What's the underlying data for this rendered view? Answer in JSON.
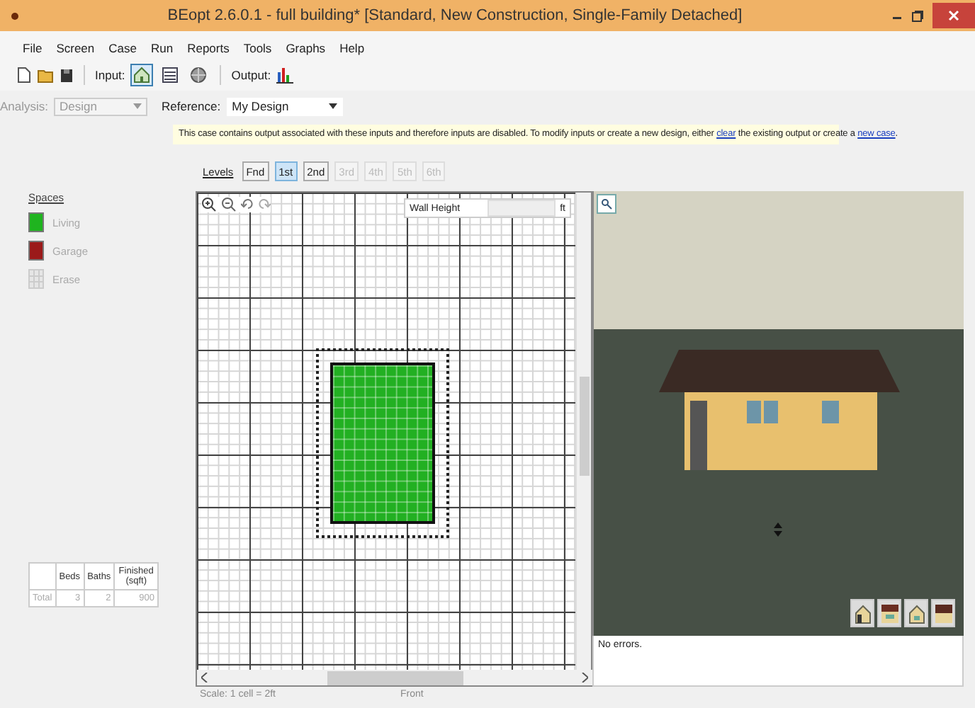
{
  "window": {
    "title": "BEopt 2.6.0.1 - full building* [Standard, New Construction, Single-Family Detached]"
  },
  "menu": [
    "File",
    "Screen",
    "Case",
    "Run",
    "Reports",
    "Tools",
    "Graphs",
    "Help"
  ],
  "toolbar": {
    "input_label": "Input:",
    "input_views": [
      {
        "kind": "house",
        "selected": true
      },
      {
        "kind": "list",
        "selected": false
      },
      {
        "kind": "globe",
        "selected": false
      }
    ],
    "output_label": "Output:"
  },
  "analysis": {
    "label": "Analysis:",
    "value": "Design",
    "disabled": true
  },
  "reference": {
    "label": "Reference:",
    "value": "My Design"
  },
  "banner": [
    {
      "kind": "text",
      "text": "This case contains output associated with these inputs and therefore inputs are disabled. To modify inputs or create a new design, either "
    },
    {
      "kind": "link",
      "text": "clear"
    },
    {
      "kind": "text",
      "text": " the existing output or create a "
    },
    {
      "kind": "link",
      "text": "new case"
    },
    {
      "kind": "text",
      "text": "."
    }
  ],
  "levels": {
    "label": "Levels",
    "items": [
      {
        "label": "Fnd",
        "selected": false,
        "disabled": false
      },
      {
        "label": "1st",
        "selected": true,
        "disabled": false
      },
      {
        "label": "2nd",
        "selected": false,
        "disabled": false
      },
      {
        "label": "3rd",
        "selected": false,
        "disabled": true
      },
      {
        "label": "4th",
        "selected": false,
        "disabled": true
      },
      {
        "label": "5th",
        "selected": false,
        "disabled": true
      },
      {
        "label": "6th",
        "selected": false,
        "disabled": true
      }
    ]
  },
  "spaces": {
    "title": "Spaces",
    "items": [
      {
        "label": "Living",
        "kind": "swatch",
        "color": "#1fb41f"
      },
      {
        "label": "Garage",
        "kind": "swatch",
        "color": "#9b1a1a"
      },
      {
        "label": "Erase",
        "kind": "erase"
      }
    ]
  },
  "summary": {
    "columns": [
      "Beds",
      "Baths",
      "Finished (sqft)"
    ],
    "rows": [
      {
        "label": "Total",
        "cells": [
          "3",
          "2",
          "900"
        ]
      }
    ]
  },
  "wall_height": {
    "label": "Wall Height",
    "unit": "ft"
  },
  "status": "No errors.",
  "footer": {
    "scale": "Scale: 1 cell = 2ft",
    "view": "Front"
  }
}
